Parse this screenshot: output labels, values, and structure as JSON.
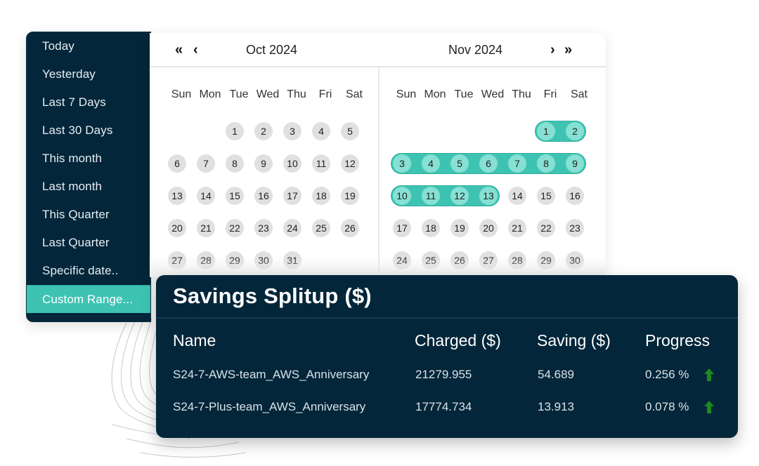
{
  "presets": [
    {
      "label": "Today",
      "active": false
    },
    {
      "label": "Yesterday",
      "active": false
    },
    {
      "label": "Last 7 Days",
      "active": false
    },
    {
      "label": "Last 30 Days",
      "active": false
    },
    {
      "label": "This month",
      "active": false
    },
    {
      "label": "Last month",
      "active": false
    },
    {
      "label": "This Quarter",
      "active": false
    },
    {
      "label": "Last Quarter",
      "active": false
    },
    {
      "label": "Specific date..",
      "active": false
    },
    {
      "label": "Custom Range...",
      "active": true
    }
  ],
  "calendar": {
    "nav": {
      "prev_year_icon": "double-chevron-left-icon",
      "prev_month_icon": "chevron-left-icon",
      "next_month_icon": "chevron-right-icon",
      "next_year_icon": "double-chevron-right-icon",
      "prev_year_glyph": "«",
      "prev_month_glyph": "‹",
      "next_month_glyph": "›",
      "next_year_glyph": "»"
    },
    "weekdays": [
      "Sun",
      "Mon",
      "Tue",
      "Wed",
      "Thu",
      "Fri",
      "Sat"
    ],
    "months": [
      {
        "title": "Oct 2024",
        "first_weekday": 2,
        "days_in_month": 31,
        "selected": []
      },
      {
        "title": "Nov 2024",
        "first_weekday": 5,
        "days_in_month": 30,
        "selected": [
          1,
          2,
          3,
          4,
          5,
          6,
          7,
          8,
          9,
          10,
          11,
          12,
          13
        ]
      }
    ]
  },
  "savings": {
    "title": "Savings Splitup ($)",
    "columns": [
      "Name",
      "Charged ($)",
      "Saving ($)",
      "Progress"
    ],
    "rows": [
      {
        "name": "S24-7-AWS-team_AWS_Anniversary",
        "charged": "21279.955",
        "saving": "54.689",
        "progress": "0.256 %",
        "trend": "up"
      },
      {
        "name": "S24-7-Plus-team_AWS_Anniversary",
        "charged": "17774.734",
        "saving": "13.913",
        "progress": "0.078 %",
        "trend": "up"
      }
    ]
  },
  "colors": {
    "navy": "#04263a",
    "accent": "#3ec3b3",
    "selected_day": "#86e0d3",
    "day": "#e0e0e0",
    "trend_up": "#1e8a1e"
  }
}
